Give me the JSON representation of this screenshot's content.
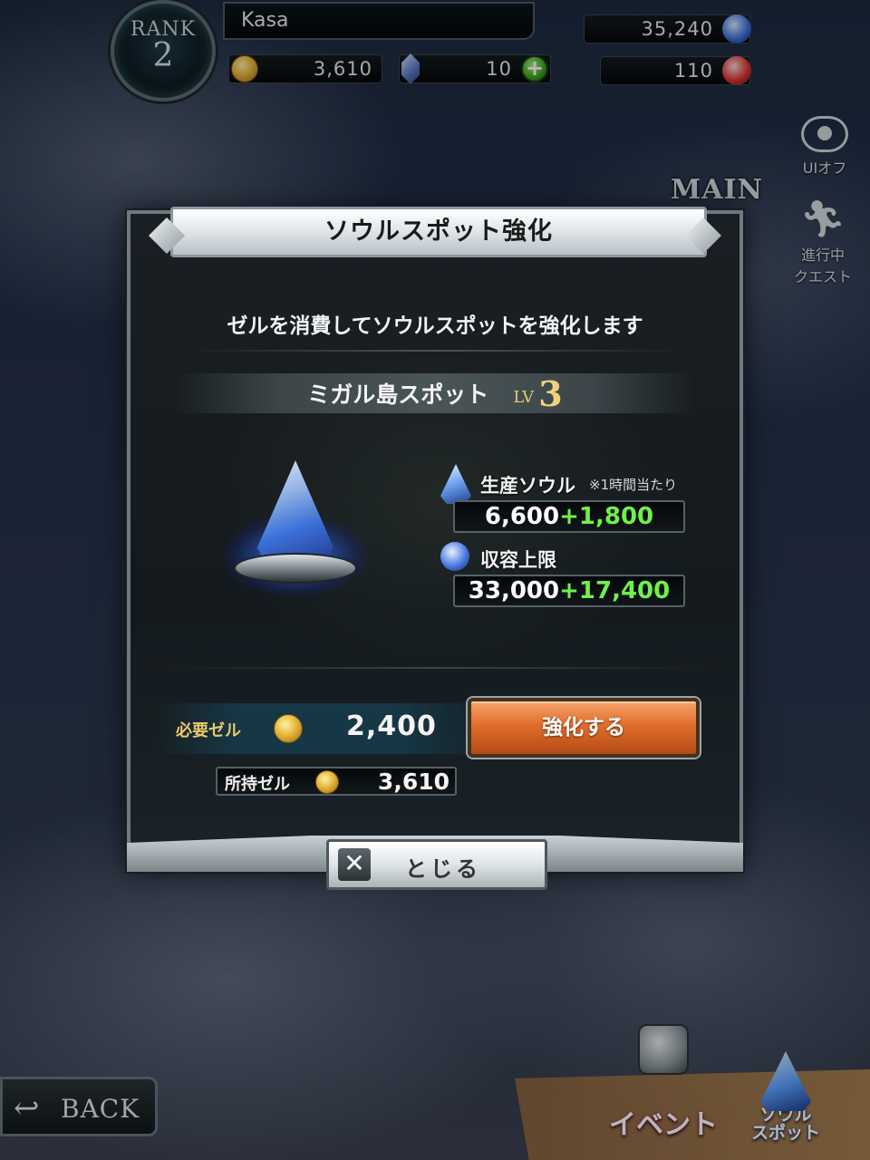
{
  "hud": {
    "rank_label": "RANK",
    "rank_value": "2",
    "player_name": "Kasa",
    "gil": "3,610",
    "crystals": "10",
    "soul_total": "35,240",
    "red_currency": "110"
  },
  "side_menu": {
    "ui_off": "UIオフ",
    "quest_line1": "進行中",
    "quest_line2": "クエスト",
    "main_story": "MAIN"
  },
  "dialog": {
    "title": "ソウルスポット強化",
    "description": "ゼルを消費してソウルスポットを強化します",
    "spot_name": "ミガル島スポット",
    "level_label": "LV",
    "level_value": "3",
    "production": {
      "label": "生産ソウル",
      "note": "※1時間当たり",
      "base": "6,600",
      "plus": "+1,800"
    },
    "capacity": {
      "label": "収容上限",
      "base": "33,000",
      "plus": "+17,400"
    },
    "cost_label": "必要ゼル",
    "cost_value": "2,400",
    "enhance_button": "強化する",
    "owned_label": "所持ゼル",
    "owned_value": "3,610",
    "close_button": "とじる"
  },
  "bottom": {
    "back_label": "BACK",
    "event_label": "イベント",
    "soul_spot_label1": "ソウル",
    "soul_spot_label2": "スポット"
  },
  "colors": {
    "plus_value": "#6ff04a",
    "enhance_button": "#e06e2c",
    "cost_label": "#e9c96c"
  }
}
